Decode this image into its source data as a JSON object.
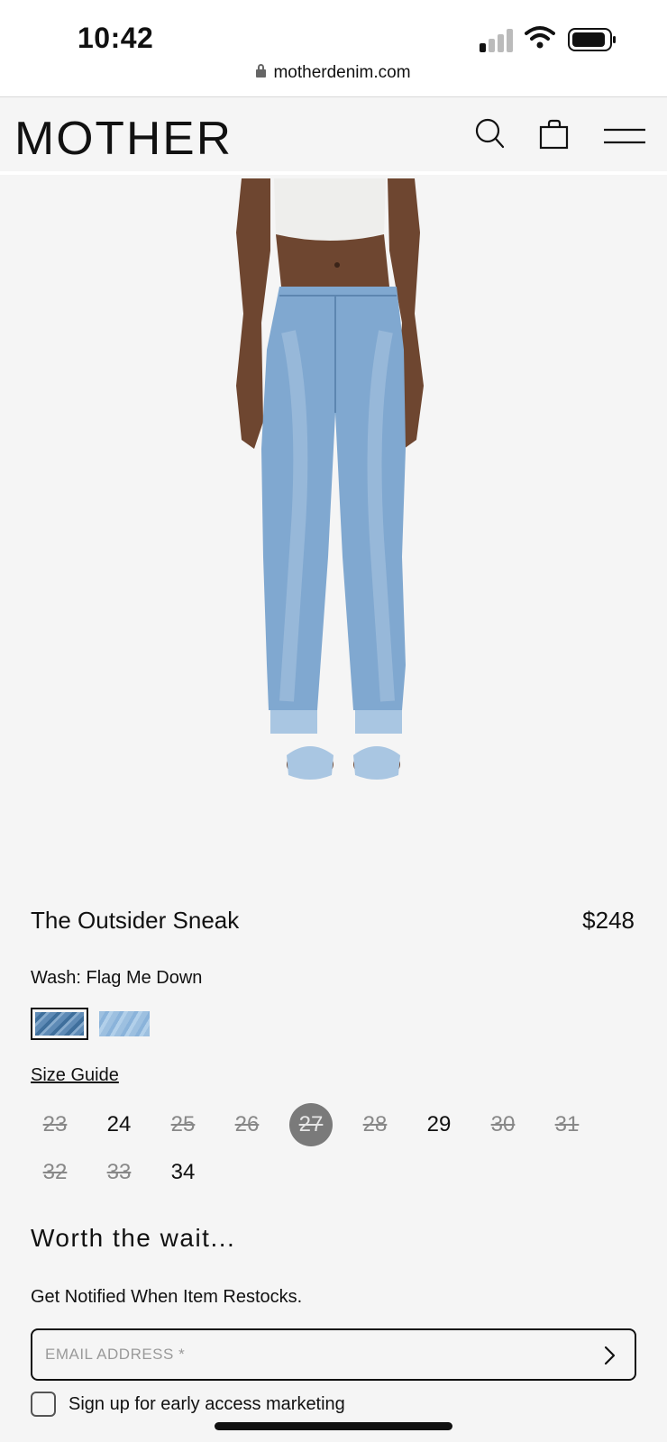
{
  "status_bar": {
    "time": "10:42"
  },
  "browser": {
    "url": "motherdenim.com"
  },
  "header": {
    "logo": "MOTHER"
  },
  "product": {
    "name": "The Outsider Sneak",
    "price": "$248",
    "wash_label": "Wash: Flag Me Down",
    "size_guide": "Size Guide",
    "sizes": [
      {
        "label": "23",
        "available": false
      },
      {
        "label": "24",
        "available": true
      },
      {
        "label": "25",
        "available": false
      },
      {
        "label": "26",
        "available": false
      },
      {
        "label": "27",
        "available": false,
        "selected": true
      },
      {
        "label": "28",
        "available": false
      },
      {
        "label": "29",
        "available": true
      },
      {
        "label": "30",
        "available": false
      },
      {
        "label": "31",
        "available": false
      },
      {
        "label": "32",
        "available": false
      },
      {
        "label": "33",
        "available": false
      },
      {
        "label": "34",
        "available": true
      }
    ]
  },
  "restock": {
    "heading": "Worth the wait...",
    "subtext": "Get Notified When Item Restocks.",
    "email_placeholder": "EMAIL ADDRESS *",
    "checkbox_label": "Sign up for early access marketing"
  },
  "colors": {
    "background": "#f5f5f5",
    "text": "#111111",
    "out_of_stock": "#888888",
    "selected_size_bg": "#7a7a7a"
  }
}
